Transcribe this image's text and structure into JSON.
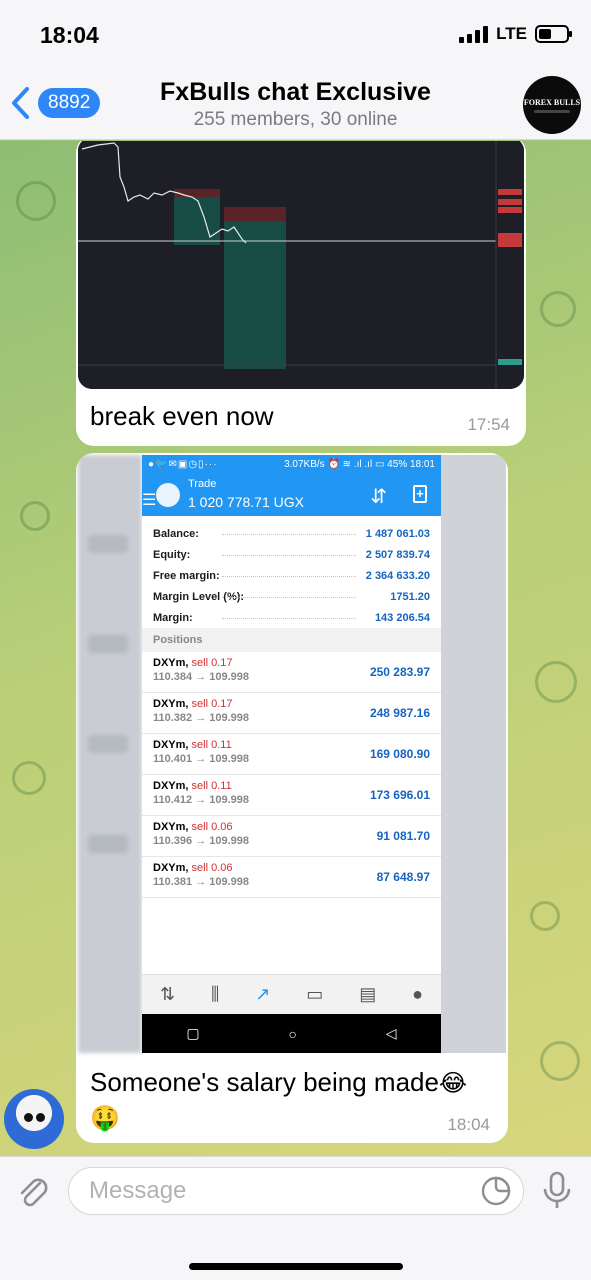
{
  "status_bar": {
    "time": "18:04",
    "network": "LTE"
  },
  "header": {
    "back_count": "8892",
    "title": "FxBulls chat Exclusive",
    "subtitle": "255 members, 30 online",
    "avatar_text": "FOREX BULLS"
  },
  "messages": [
    {
      "text": "break even now",
      "time": "17:54",
      "image": "chart-screenshot"
    },
    {
      "text": "Someone's salary being made",
      "emoji": "😂🤑",
      "time": "18:04",
      "image": "trade-screenshot"
    }
  ],
  "trade_screenshot": {
    "status_left": "●🐦✉▣◷▯···",
    "status_speed": "3.07KB/s ⏰ ≋ .ıl .ıl ▭ 45% 18:01",
    "app_title": "Trade",
    "app_balance": "1 020 778.71 UGX",
    "account": [
      {
        "label": "Balance:",
        "value": "1 487 061.03"
      },
      {
        "label": "Equity:",
        "value": "2 507 839.74"
      },
      {
        "label": "Free margin:",
        "value": "2 364 633.20"
      },
      {
        "label": "Margin Level (%):",
        "value": "1751.20"
      },
      {
        "label": "Margin:",
        "value": "143 206.54"
      }
    ],
    "positions_header": "Positions",
    "positions": [
      {
        "symbol": "DXYm,",
        "side": "sell 0.17",
        "prices": "110.384 → 109.998",
        "profit": "250 283.97"
      },
      {
        "symbol": "DXYm,",
        "side": "sell 0.17",
        "prices": "110.382 → 109.998",
        "profit": "248 987.16"
      },
      {
        "symbol": "DXYm,",
        "side": "sell 0.11",
        "prices": "110.401 → 109.998",
        "profit": "169 080.90"
      },
      {
        "symbol": "DXYm,",
        "side": "sell 0.11",
        "prices": "110.412 → 109.998",
        "profit": "173 696.01"
      },
      {
        "symbol": "DXYm,",
        "side": "sell 0.06",
        "prices": "110.396 → 109.998",
        "profit": "91 081.70"
      },
      {
        "symbol": "DXYm,",
        "side": "sell 0.06",
        "prices": "110.381 → 109.998",
        "profit": "87 648.97"
      }
    ]
  },
  "composer": {
    "placeholder": "Message"
  },
  "colors": {
    "accent": "#2f86f6",
    "app_blue": "#2196f3",
    "sell_red": "#d32f2f",
    "profit_blue": "#1565c0"
  }
}
